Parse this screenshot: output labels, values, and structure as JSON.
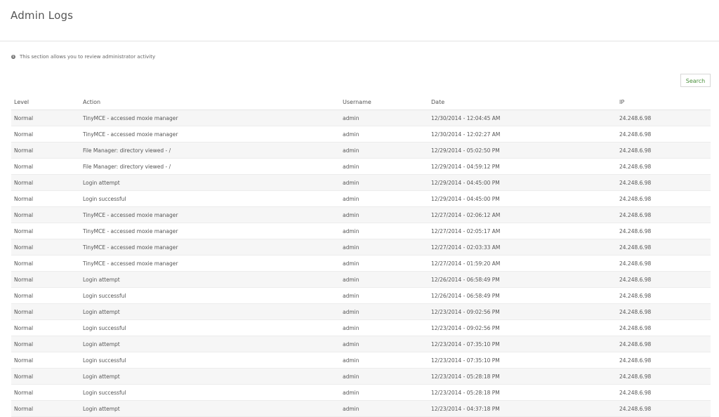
{
  "page": {
    "title": "Admin Logs"
  },
  "info": {
    "icon": "info-icon",
    "text": "This section allows you to review administrator activity"
  },
  "toolbar": {
    "search_label": "Search"
  },
  "table": {
    "columns": [
      "Level",
      "Action",
      "Username",
      "Date",
      "IP"
    ],
    "rows": [
      [
        "Normal",
        "TinyMCE - accessed moxie manager",
        "admin",
        "12/30/2014 - 12:04:45 AM",
        "24.248.6.98"
      ],
      [
        "Normal",
        "TinyMCE - accessed moxie manager",
        "admin",
        "12/30/2014 - 12:02:27 AM",
        "24.248.6.98"
      ],
      [
        "Normal",
        "File Manager: directory viewed - /",
        "admin",
        "12/29/2014 - 05:02:50 PM",
        "24.248.6.98"
      ],
      [
        "Normal",
        "File Manager: directory viewed - /",
        "admin",
        "12/29/2014 - 04:59:12 PM",
        "24.248.6.98"
      ],
      [
        "Normal",
        "Login attempt",
        "admin",
        "12/29/2014 - 04:45:00 PM",
        "24.248.6.98"
      ],
      [
        "Normal",
        "Login successful",
        "admin",
        "12/29/2014 - 04:45:00 PM",
        "24.248.6.98"
      ],
      [
        "Normal",
        "TinyMCE - accessed moxie manager",
        "admin",
        "12/27/2014 - 02:06:12 AM",
        "24.248.6.98"
      ],
      [
        "Normal",
        "TinyMCE - accessed moxie manager",
        "admin",
        "12/27/2014 - 02:05:17 AM",
        "24.248.6.98"
      ],
      [
        "Normal",
        "TinyMCE - accessed moxie manager",
        "admin",
        "12/27/2014 - 02:03:33 AM",
        "24.248.6.98"
      ],
      [
        "Normal",
        "TinyMCE - accessed moxie manager",
        "admin",
        "12/27/2014 - 01:59:20 AM",
        "24.248.6.98"
      ],
      [
        "Normal",
        "Login attempt",
        "admin",
        "12/26/2014 - 06:58:49 PM",
        "24.248.6.98"
      ],
      [
        "Normal",
        "Login successful",
        "admin",
        "12/26/2014 - 06:58:49 PM",
        "24.248.6.98"
      ],
      [
        "Normal",
        "Login attempt",
        "admin",
        "12/23/2014 - 09:02:56 PM",
        "24.248.6.98"
      ],
      [
        "Normal",
        "Login successful",
        "admin",
        "12/23/2014 - 09:02:56 PM",
        "24.248.6.98"
      ],
      [
        "Normal",
        "Login attempt",
        "admin",
        "12/23/2014 - 07:35:10 PM",
        "24.248.6.98"
      ],
      [
        "Normal",
        "Login successful",
        "admin",
        "12/23/2014 - 07:35:10 PM",
        "24.248.6.98"
      ],
      [
        "Normal",
        "Login attempt",
        "admin",
        "12/23/2014 - 05:28:18 PM",
        "24.248.6.98"
      ],
      [
        "Normal",
        "Login successful",
        "admin",
        "12/23/2014 - 05:28:18 PM",
        "24.248.6.98"
      ],
      [
        "Normal",
        "Login attempt",
        "admin",
        "12/23/2014 - 04:37:18 PM",
        "24.248.6.98"
      ]
    ]
  },
  "colors": {
    "accent": "#4a8f3c",
    "row_stripe": "#f6f6f6",
    "border": "#e3e3e3"
  }
}
